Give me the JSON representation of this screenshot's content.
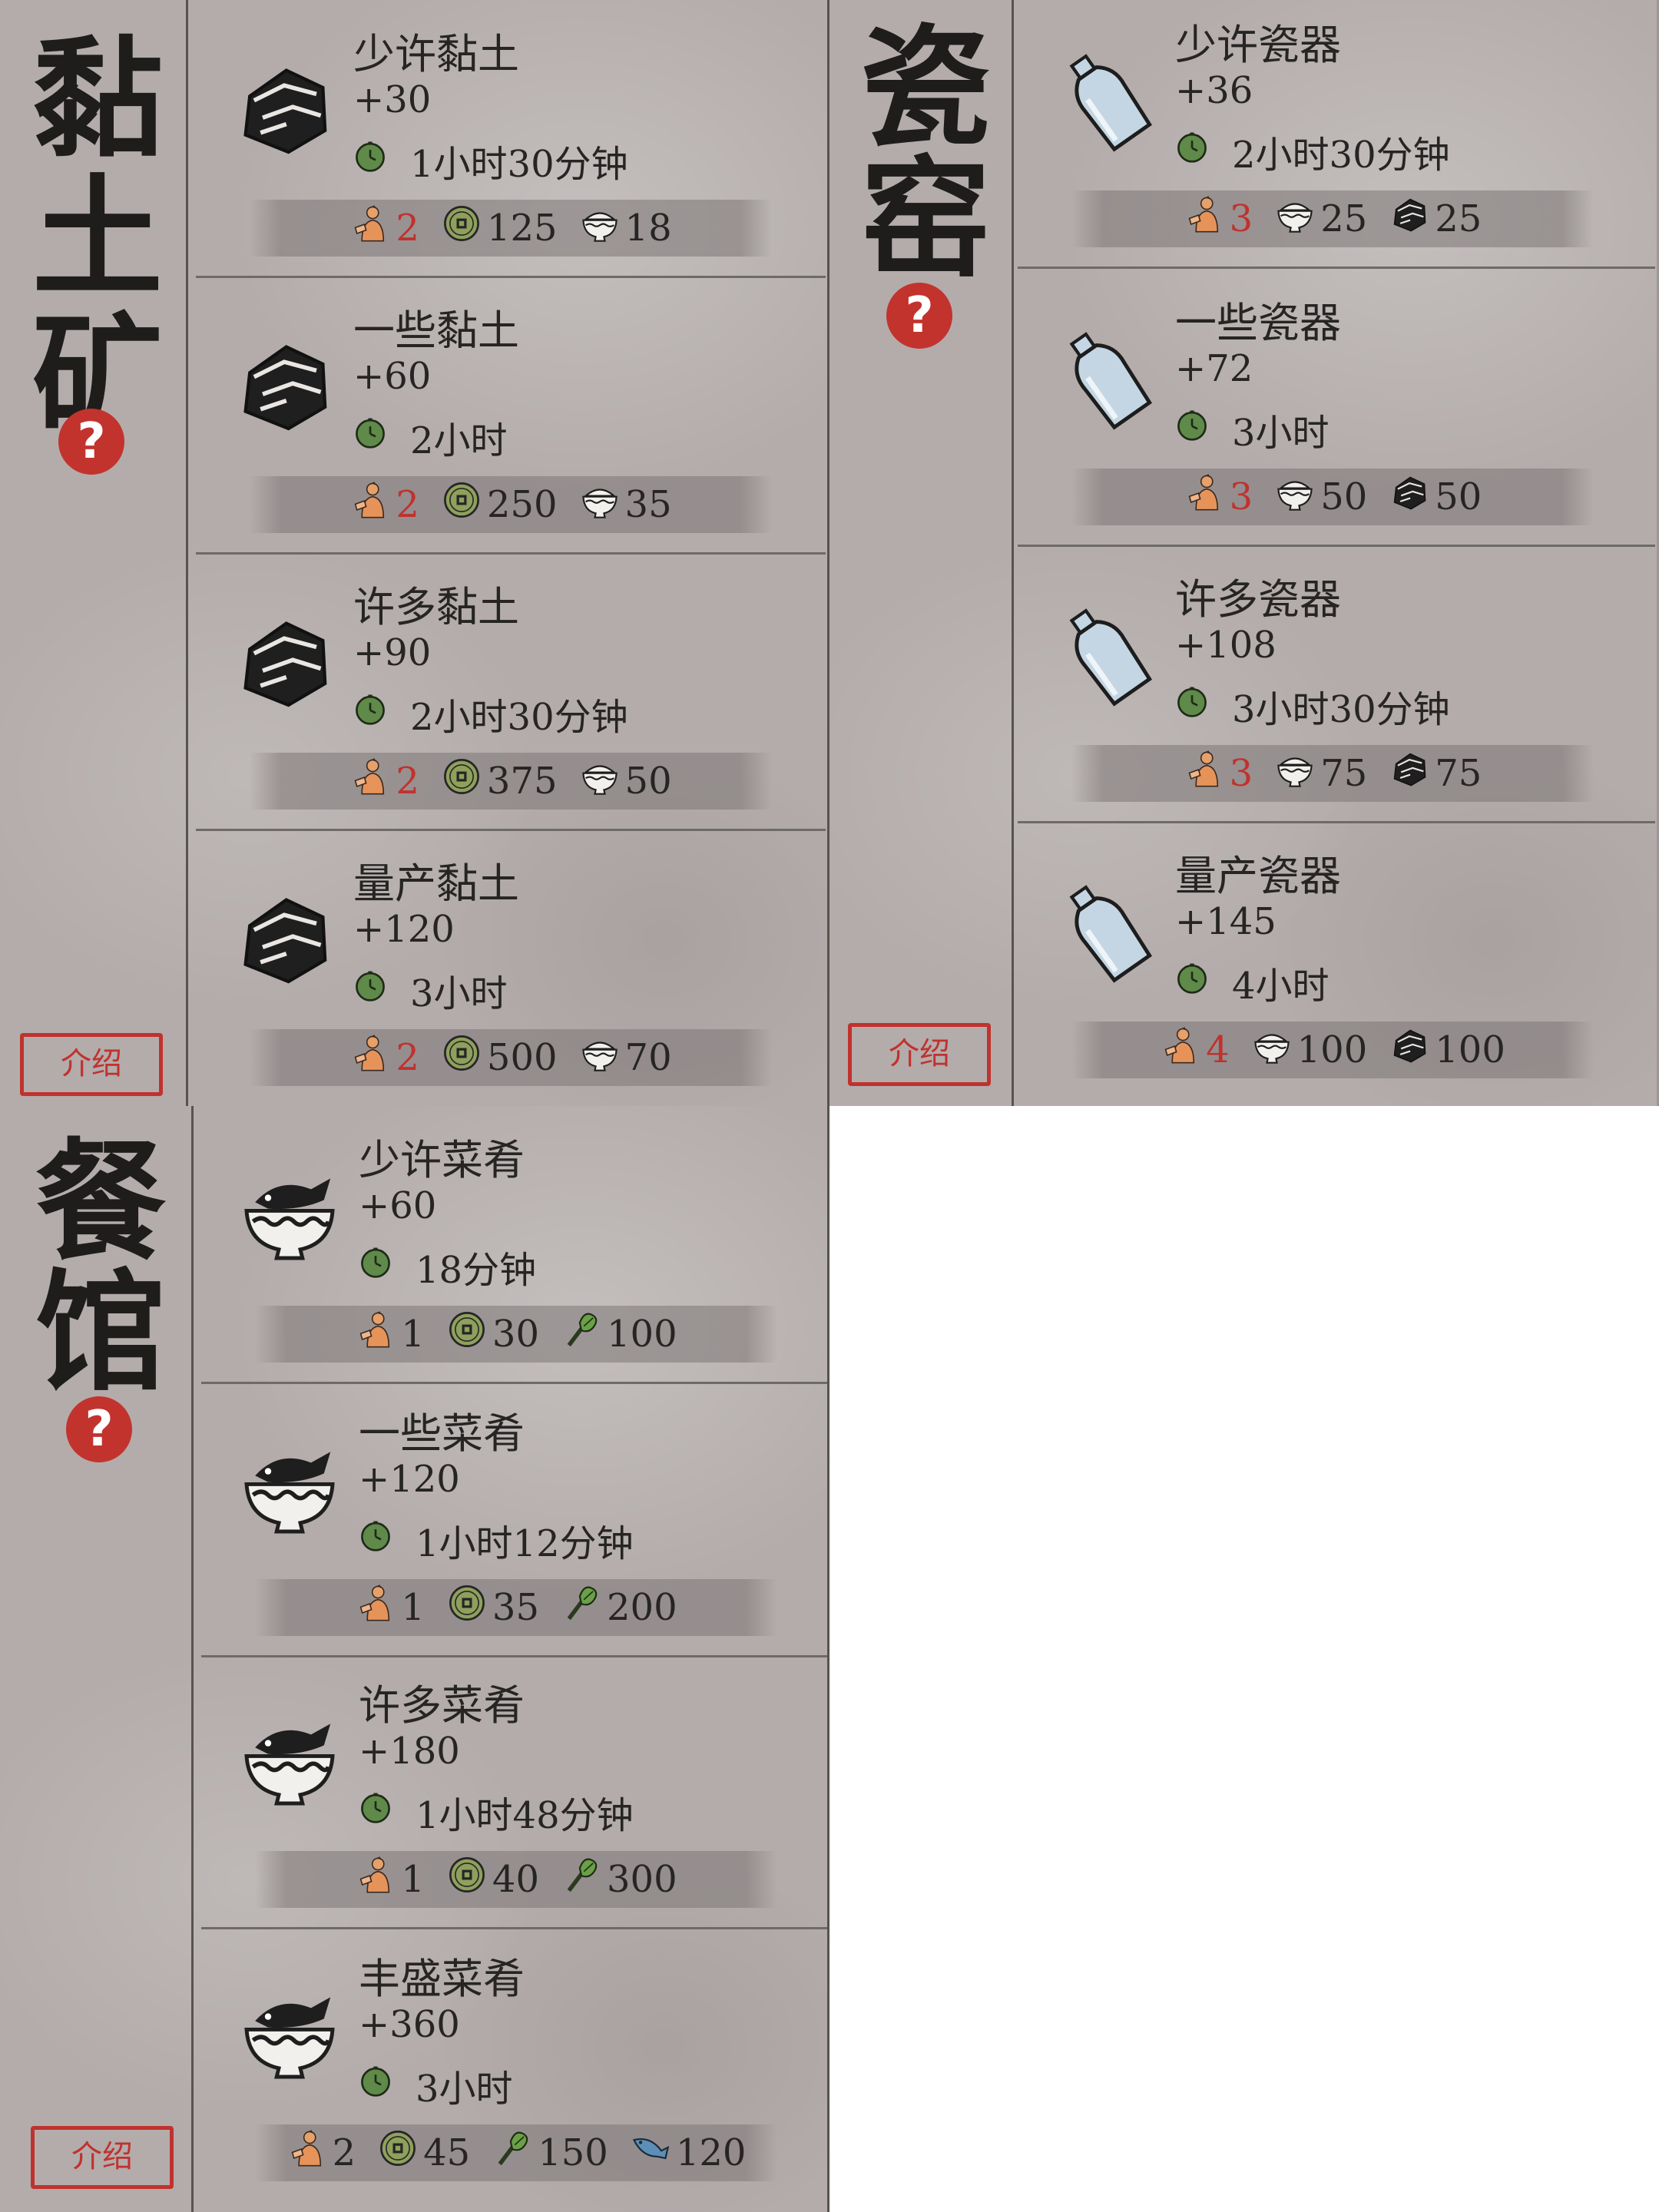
{
  "colors": {
    "paper": "#b3acab",
    "accent_red": "#c0322e",
    "ink": "#262524"
  },
  "panels": [
    {
      "title_chars": [
        "黏",
        "土",
        "矿"
      ],
      "help": "?",
      "intro": "介绍",
      "icon": "clay-rock-icon",
      "entries": [
        {
          "name": "少许黏土",
          "amount": "+30",
          "time": "1小时30分钟",
          "costs": [
            {
              "icon": "worker-icon",
              "value": "2",
              "red": true
            },
            {
              "icon": "coin-icon",
              "value": "125"
            },
            {
              "icon": "rice-bowl-icon",
              "value": "18"
            }
          ]
        },
        {
          "name": "一些黏土",
          "amount": "+60",
          "time": "2小时",
          "costs": [
            {
              "icon": "worker-icon",
              "value": "2",
              "red": true
            },
            {
              "icon": "coin-icon",
              "value": "250"
            },
            {
              "icon": "rice-bowl-icon",
              "value": "35"
            }
          ]
        },
        {
          "name": "许多黏土",
          "amount": "+90",
          "time": "2小时30分钟",
          "costs": [
            {
              "icon": "worker-icon",
              "value": "2",
              "red": true
            },
            {
              "icon": "coin-icon",
              "value": "375"
            },
            {
              "icon": "rice-bowl-icon",
              "value": "50"
            }
          ]
        },
        {
          "name": "量产黏土",
          "amount": "+120",
          "time": "3小时",
          "costs": [
            {
              "icon": "worker-icon",
              "value": "2",
              "red": true
            },
            {
              "icon": "coin-icon",
              "value": "500"
            },
            {
              "icon": "rice-bowl-icon",
              "value": "70"
            }
          ]
        }
      ]
    },
    {
      "title_chars": [
        "瓷",
        "窑"
      ],
      "help": "?",
      "intro": "介绍",
      "icon": "porcelain-vase-icon",
      "entries": [
        {
          "name": "少许瓷器",
          "amount": "+36",
          "time": "2小时30分钟",
          "costs": [
            {
              "icon": "worker-icon",
              "value": "3",
              "red": true
            },
            {
              "icon": "rice-bowl-icon",
              "value": "25"
            },
            {
              "icon": "clay-rock-icon",
              "value": "25"
            }
          ]
        },
        {
          "name": "一些瓷器",
          "amount": "+72",
          "time": "3小时",
          "costs": [
            {
              "icon": "worker-icon",
              "value": "3",
              "red": true
            },
            {
              "icon": "rice-bowl-icon",
              "value": "50"
            },
            {
              "icon": "clay-rock-icon",
              "value": "50"
            }
          ]
        },
        {
          "name": "许多瓷器",
          "amount": "+108",
          "time": "3小时30分钟",
          "costs": [
            {
              "icon": "worker-icon",
              "value": "3",
              "red": true
            },
            {
              "icon": "rice-bowl-icon",
              "value": "75"
            },
            {
              "icon": "clay-rock-icon",
              "value": "75"
            }
          ]
        },
        {
          "name": "量产瓷器",
          "amount": "+145",
          "time": "4小时",
          "costs": [
            {
              "icon": "worker-icon",
              "value": "4",
              "red": true
            },
            {
              "icon": "rice-bowl-icon",
              "value": "100"
            },
            {
              "icon": "clay-rock-icon",
              "value": "100"
            }
          ]
        }
      ]
    },
    {
      "title_chars": [
        "餐",
        "馆"
      ],
      "help": "?",
      "intro": "介绍",
      "icon": "fish-bowl-icon",
      "entries": [
        {
          "name": "少许菜肴",
          "amount": "+60",
          "time": "18分钟",
          "costs": [
            {
              "icon": "worker-icon",
              "value": "1"
            },
            {
              "icon": "coin-icon",
              "value": "30"
            },
            {
              "icon": "vegetable-icon",
              "value": "100"
            }
          ]
        },
        {
          "name": "一些菜肴",
          "amount": "+120",
          "time": "1小时12分钟",
          "costs": [
            {
              "icon": "worker-icon",
              "value": "1"
            },
            {
              "icon": "coin-icon",
              "value": "35"
            },
            {
              "icon": "vegetable-icon",
              "value": "200"
            }
          ]
        },
        {
          "name": "许多菜肴",
          "amount": "+180",
          "time": "1小时48分钟",
          "costs": [
            {
              "icon": "worker-icon",
              "value": "1"
            },
            {
              "icon": "coin-icon",
              "value": "40"
            },
            {
              "icon": "vegetable-icon",
              "value": "300"
            }
          ]
        },
        {
          "name": "丰盛菜肴",
          "amount": "+360",
          "time": "3小时",
          "costs": [
            {
              "icon": "worker-icon",
              "value": "2"
            },
            {
              "icon": "coin-icon",
              "value": "45"
            },
            {
              "icon": "vegetable-icon",
              "value": "150"
            },
            {
              "icon": "fish-icon",
              "value": "120"
            }
          ]
        }
      ]
    }
  ]
}
